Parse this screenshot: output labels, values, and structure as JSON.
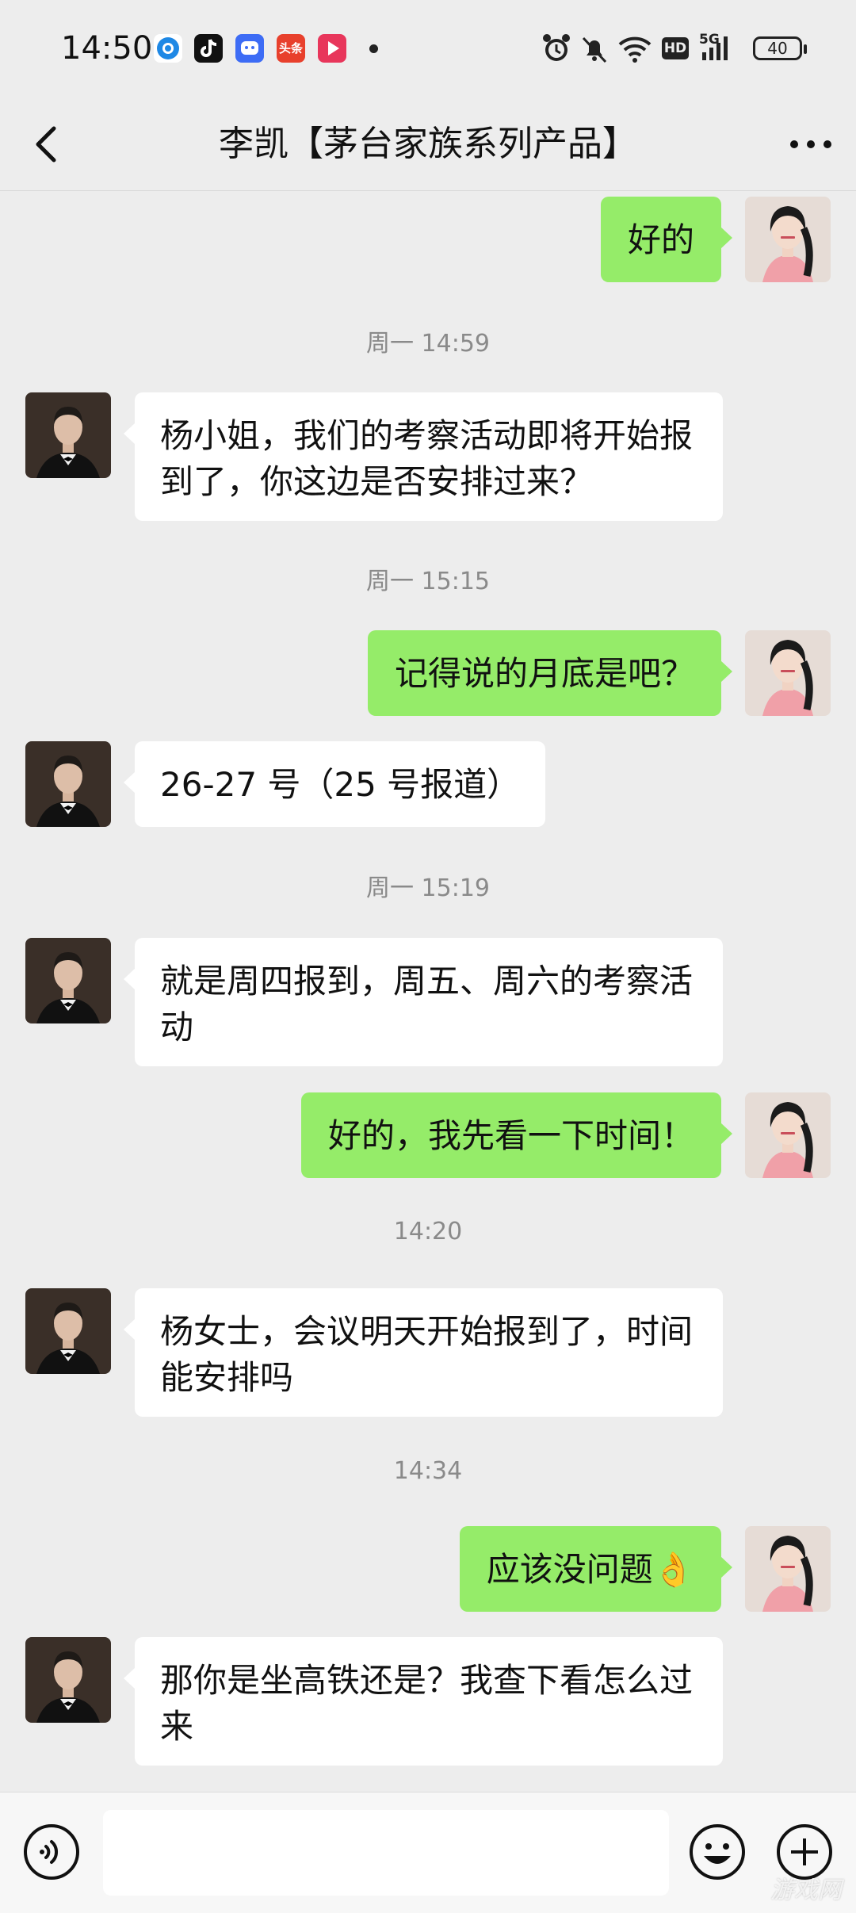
{
  "status_bar": {
    "time": "14:50",
    "battery": "40",
    "network": "5G",
    "hd": "HD",
    "toutiao_label": "头条"
  },
  "header": {
    "title": "李凯【茅台家族系列产品】"
  },
  "messages": [
    {
      "type": "bubble",
      "side": "right",
      "text": "好的"
    },
    {
      "type": "time",
      "text": "周一 14:59"
    },
    {
      "type": "bubble",
      "side": "left",
      "text": "杨小姐，我们的考察活动即将开始报到了，你这边是否安排过来？"
    },
    {
      "type": "time",
      "text": "周一 15:15"
    },
    {
      "type": "bubble",
      "side": "right",
      "text": "记得说的月底是吧？"
    },
    {
      "type": "bubble",
      "side": "left",
      "text": "26-27 号（25 号报道）"
    },
    {
      "type": "time",
      "text": "周一 15:19"
    },
    {
      "type": "bubble",
      "side": "left",
      "text": "就是周四报到，周五、周六的考察活动"
    },
    {
      "type": "bubble",
      "side": "right",
      "text": "好的，我先看一下时间！"
    },
    {
      "type": "time",
      "text": "14:20"
    },
    {
      "type": "bubble",
      "side": "left",
      "text": "杨女士，会议明天开始报到了，时间能安排吗"
    },
    {
      "type": "time",
      "text": "14:34"
    },
    {
      "type": "bubble",
      "side": "right",
      "text": "应该没问题",
      "emoji": "👌"
    },
    {
      "type": "bubble",
      "side": "left",
      "text": "那你是坐高铁还是？我查下看怎么过来"
    }
  ],
  "input_bar": {
    "placeholder": ""
  },
  "watermark": "游戏网",
  "colors": {
    "background": "#ededed",
    "self_bubble": "#95ec69",
    "other_bubble": "#ffffff",
    "timestamp": "#8a8a8a"
  }
}
